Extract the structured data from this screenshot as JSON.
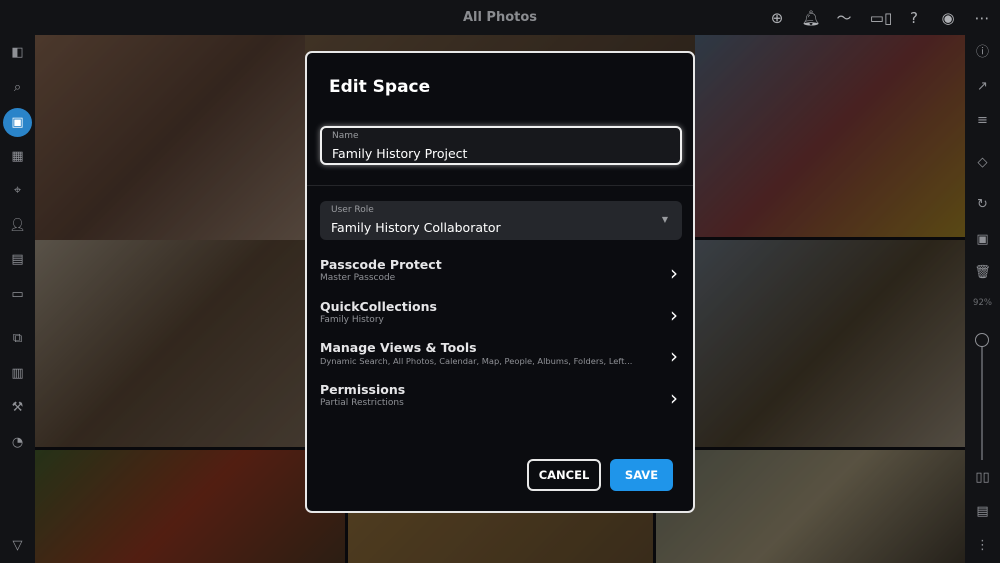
{
  "header": {
    "title": "All Photos",
    "icons": [
      "add-icon",
      "bell-icon",
      "activity-icon",
      "devices-icon",
      "help-icon",
      "account-icon",
      "more-icon"
    ]
  },
  "right_sidebar": {
    "zoom_level": "92%",
    "zoom_fraction": 0.92
  },
  "dialog": {
    "title": "Edit Space",
    "name_field": {
      "label": "Name",
      "value": "Family History Project"
    },
    "role_select": {
      "label": "User Role",
      "value": "Family History Collaborator"
    },
    "rows": [
      {
        "title": "Passcode Protect",
        "subtitle": "Master Passcode"
      },
      {
        "title": "QuickCollections",
        "subtitle": "Family History"
      },
      {
        "title": "Manage Views & Tools",
        "subtitle": "Dynamic Search, All Photos, Calendar, Map, People, Albums, Folders, Left..."
      },
      {
        "title": "Permissions",
        "subtitle": "Partial Restrictions"
      }
    ],
    "cancel_label": "CANCEL",
    "save_label": "SAVE"
  },
  "colors": {
    "accent": "#1f95ea",
    "active_nav": "#2a84c9"
  }
}
